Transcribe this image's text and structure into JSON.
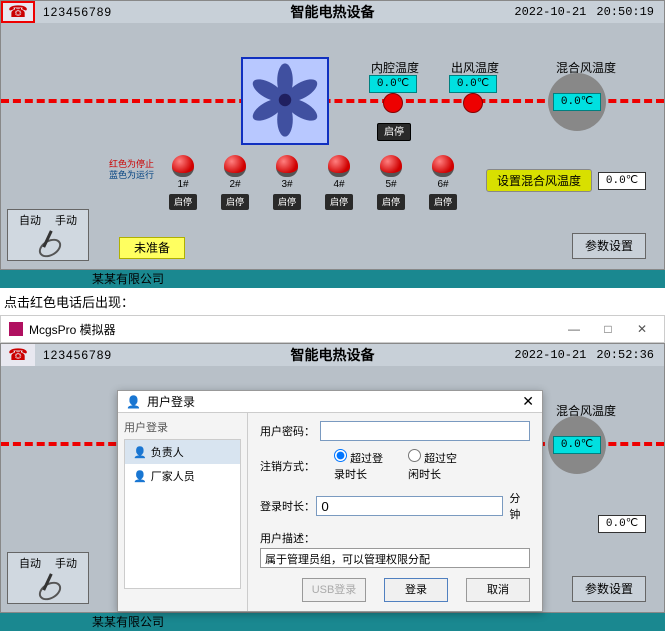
{
  "header": {
    "phone_number": "123456789",
    "title": "智能电热设备",
    "date": "2022-10-21",
    "time1": "20:50:19",
    "time2": "20:52:36"
  },
  "temps": {
    "cavity_label": "内腔温度",
    "cavity_value": "0.0℃",
    "outlet_label": "出风温度",
    "outlet_value": "0.0℃",
    "mix_label": "混合风温度",
    "mix_value": "0.0℃"
  },
  "fan_btn": "启停",
  "status_hint_red": "红色为停止",
  "status_hint_blue": "蓝色为运行",
  "lights": [
    {
      "num": "1#",
      "btn": "启停"
    },
    {
      "num": "2#",
      "btn": "启停"
    },
    {
      "num": "3#",
      "btn": "启停"
    },
    {
      "num": "4#",
      "btn": "启停"
    },
    {
      "num": "5#",
      "btn": "启停"
    },
    {
      "num": "6#",
      "btn": "启停"
    }
  ],
  "set_mix": {
    "label": "设置混合风温度",
    "value": "0.0℃"
  },
  "mode": {
    "auto": "自动",
    "manual": "手动"
  },
  "ready": "未准备",
  "param_btn": "参数设置",
  "footer": "某某有限公司",
  "caption": "点击红色电话后出现：",
  "sim_title": "McgsPro 模拟器",
  "dialog": {
    "title": "用户登录",
    "left_header": "用户登录",
    "users": [
      {
        "name": "负责人",
        "selected": true
      },
      {
        "name": "厂家人员",
        "selected": false
      }
    ],
    "pwd_label": "用户密码：",
    "pwd_value": "",
    "logout_label": "注销方式：",
    "radio1": "超过登录时长",
    "radio2": "超过空闲时长",
    "duration_label": "登录时长：",
    "duration_value": "0",
    "duration_unit": "分钟",
    "desc_label": "用户描述：",
    "desc_value": "属于管理员组，可以管理权限分配",
    "btn_usb": "USB登录",
    "btn_login": "登录",
    "btn_cancel": "取消"
  }
}
